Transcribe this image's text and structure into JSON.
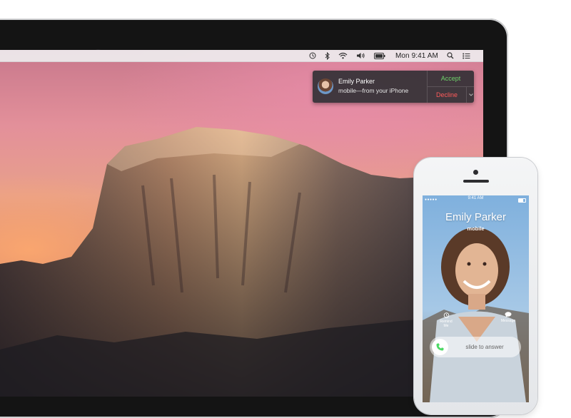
{
  "menubar": {
    "icons": [
      "time-machine-icon",
      "bluetooth-icon",
      "wifi-icon",
      "volume-icon",
      "battery-icon",
      "spotlight-search-icon",
      "notification-center-icon"
    ],
    "clock": "Mon 9:41 AM"
  },
  "notification": {
    "caller_name": "Emily Parker",
    "subtitle": "mobile—from your iPhone",
    "accept_label": "Accept",
    "decline_label": "Decline",
    "accept_color": "#6ed46a",
    "decline_color": "#ff5b5b"
  },
  "iphone": {
    "status_time": "9:41 AM",
    "caller_name": "Emily Parker",
    "caller_label": "mobile",
    "remind_label": "Remind Me",
    "message_label": "Message",
    "slide_text": "slide to answer",
    "accent_green": "#4cd964"
  }
}
